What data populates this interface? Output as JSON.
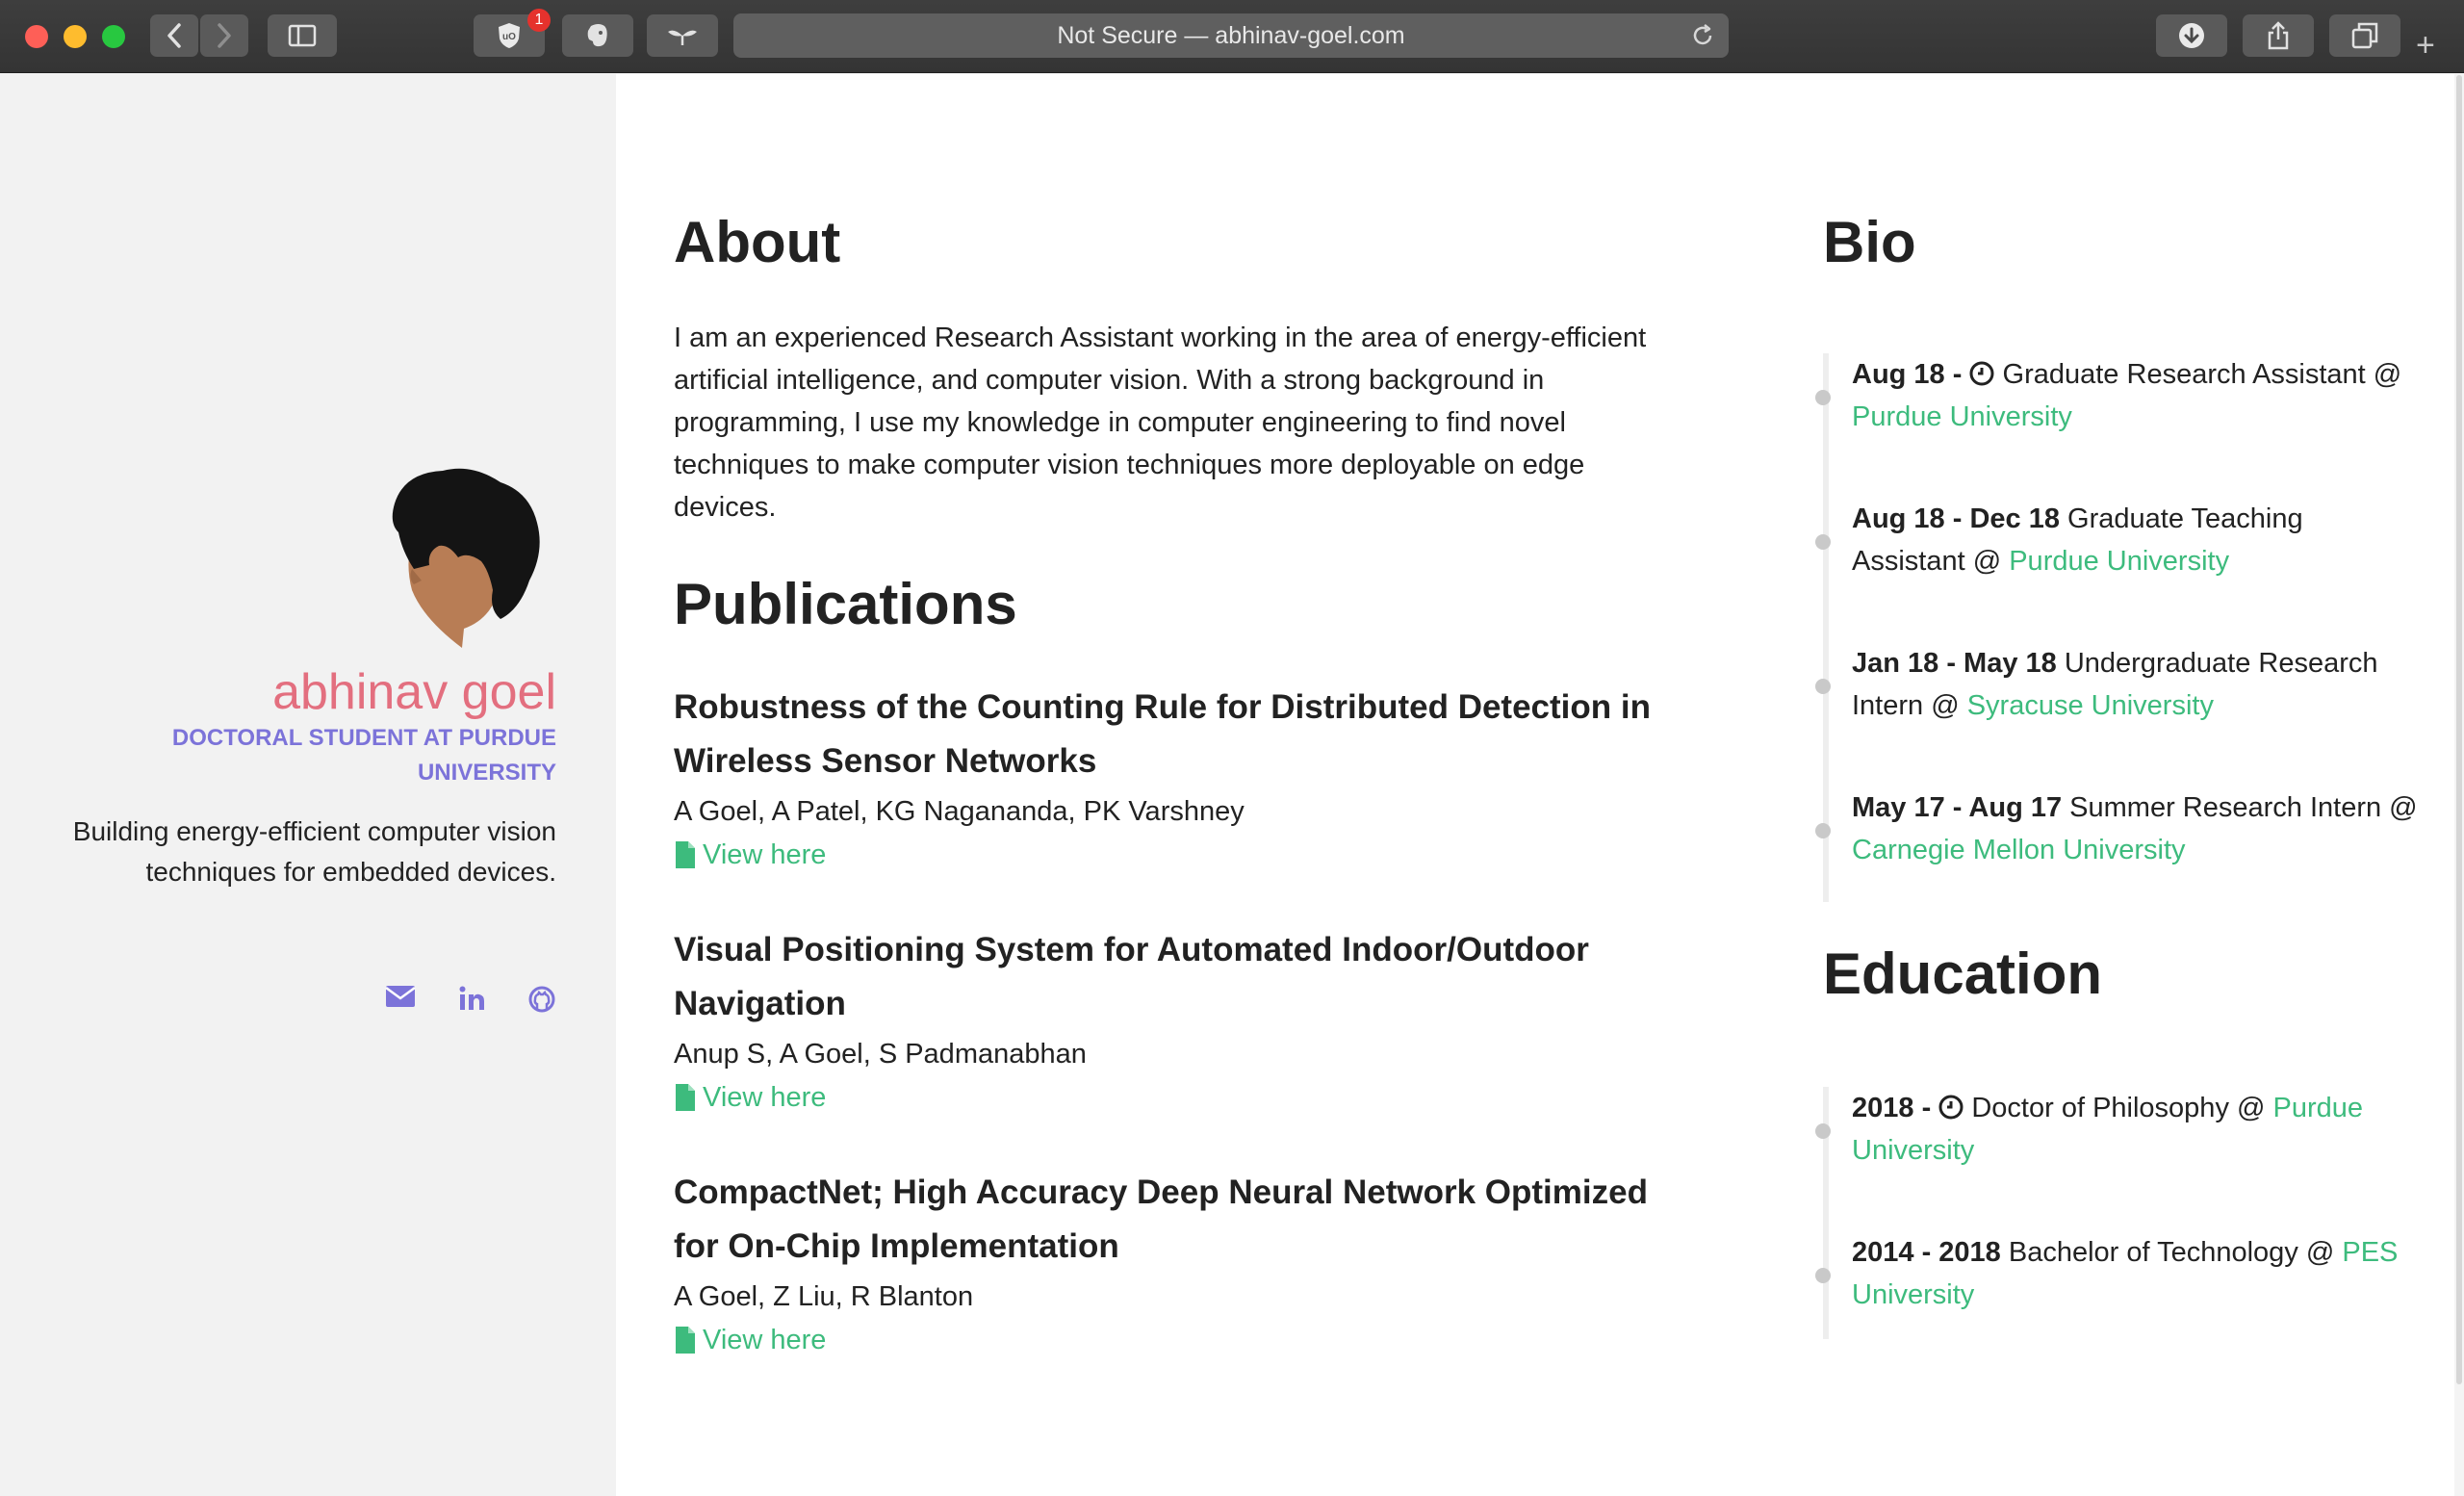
{
  "browser": {
    "url_text": "Not Secure — abhinav-goel.com",
    "extension_badge": "1"
  },
  "profile": {
    "name": "abhinav goel",
    "role": "DOCTORAL STUDENT AT PURDUE UNIVERSITY",
    "tagline": "Building energy-efficient computer vision techniques for embedded devices.",
    "socials": [
      "email-icon",
      "linkedin-icon",
      "github-icon"
    ]
  },
  "about": {
    "heading": "About",
    "text": "I am an experienced Research Assistant working in the area of energy-efficient artificial intelligence, and computer vision. With a strong background in programming, I use my knowledge in computer engineering to find novel techniques to make computer vision techniques more deployable on edge devices."
  },
  "publications": {
    "heading": "Publications",
    "items": [
      {
        "title": "Robustness of the Counting Rule for Distributed Detection in Wireless Sensor Networks",
        "authors": "A Goel, A Patel, KG Nagananda, PK Varshney",
        "link": "View here"
      },
      {
        "title": "Visual Positioning System for Automated Indoor/Outdoor Navigation",
        "authors": "Anup S, A Goel, S Padmanabhan",
        "link": "View here"
      },
      {
        "title": "CompactNet; High Accuracy Deep Neural Network Optimized for On-Chip Implementation",
        "authors": "A Goel, Z Liu, R Blanton",
        "link": "View here"
      }
    ]
  },
  "bio": {
    "heading": "Bio",
    "items": [
      {
        "date": "Aug 18 - ",
        "role": " Graduate Research Assistant @ ",
        "org": "Purdue University",
        "current": true
      },
      {
        "date": "Aug 18 - Dec 18",
        "role": " Graduate Teaching Assistant @ ",
        "org": "Purdue University",
        "current": false
      },
      {
        "date": "Jan 18 - May 18",
        "role": " Undergraduate Research Intern @ ",
        "org": "Syracuse University",
        "current": false
      },
      {
        "date": "May 17 - Aug 17",
        "role": " Summer Research Intern @ ",
        "org": "Carnegie Mellon University",
        "current": false
      }
    ]
  },
  "education": {
    "heading": "Education",
    "items": [
      {
        "date": "2018 - ",
        "role": " Doctor of Philosophy @ ",
        "org": "Purdue University",
        "current": true
      },
      {
        "date": "2014 - 2018",
        "role": " Bachelor of Technology @ ",
        "org": "PES University",
        "current": false
      }
    ]
  },
  "colors": {
    "accent_green": "#3dbb7d",
    "accent_purple": "#7c73d9",
    "name_pink": "#e36f7f"
  }
}
